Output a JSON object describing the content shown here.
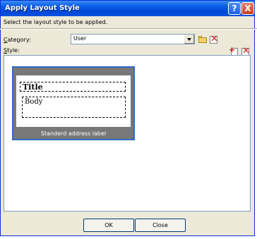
{
  "window": {
    "title": "Apply Layout Style",
    "help_button": "?",
    "close_button": "X"
  },
  "instruction": "Select the layout style to be applied.",
  "category": {
    "label_prefix": "C",
    "label_rest": "ategory:",
    "value": "User"
  },
  "style": {
    "label_prefix": "S",
    "label_rest": "tyle:"
  },
  "style_items": [
    {
      "preview_title": "Title",
      "preview_body": "Body",
      "caption": "Standerd address label"
    }
  ],
  "buttons": {
    "ok": "OK",
    "close": "Close"
  },
  "colors": {
    "title_bar": "#0a5ee8",
    "selection_border": "#3169c6",
    "dialog_bg": "#ece9d8"
  },
  "icons": [
    "add-category-icon",
    "delete-category-icon",
    "add-style-icon",
    "delete-style-icon",
    "dropdown-arrow-icon"
  ]
}
